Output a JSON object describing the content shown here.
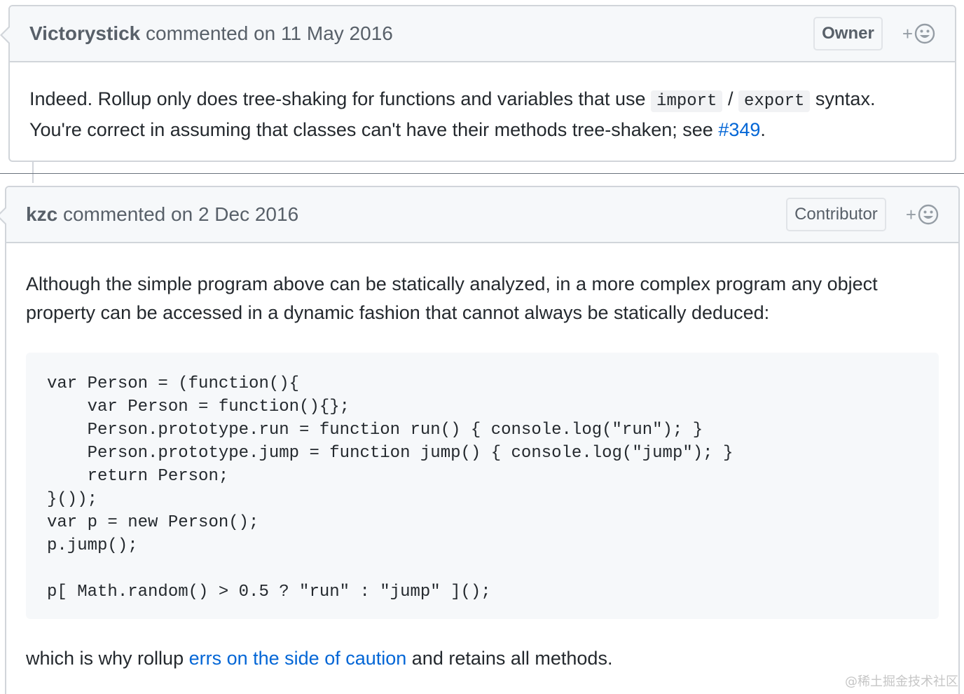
{
  "comments": [
    {
      "author": "Victorystick",
      "action": "commented on",
      "date": "11 May 2016",
      "role": "Owner",
      "reaction_plus": "+",
      "body": {
        "part1": "Indeed. Rollup only does tree-shaking for functions and variables that use ",
        "code1": "import",
        "sep": " / ",
        "code2": "export",
        "part2": " syntax.",
        "line2_text": "You're correct in assuming that classes can't have their methods tree-shaken; see ",
        "link": "#349",
        "line2_end": "."
      }
    },
    {
      "author": "kzc",
      "action": "commented on",
      "date": "2 Dec 2016",
      "role": "Contributor",
      "reaction_plus": "+",
      "body": {
        "intro": "Although the simple program above can be statically analyzed, in a more complex program any object property can be accessed in a dynamic fashion that cannot always be statically deduced:",
        "code": "var Person = (function(){\n    var Person = function(){};\n    Person.prototype.run = function run() { console.log(\"run\"); }\n    Person.prototype.jump = function jump() { console.log(\"jump\"); }\n    return Person;\n}());\nvar p = new Person();\np.jump();\n\np[ Math.random() > 0.5 ? \"run\" : \"jump\" ]();",
        "outro_start": "which is why rollup ",
        "outro_link": "errs on the side of caution",
        "outro_end": " and retains all methods."
      }
    }
  ],
  "watermark": "@稀土掘金技术社区",
  "icons": {
    "reaction": "smiley-icon"
  },
  "colors": {
    "link": "#0366d6",
    "header_bg": "#f6f8fa",
    "border": "#d1d5da"
  }
}
